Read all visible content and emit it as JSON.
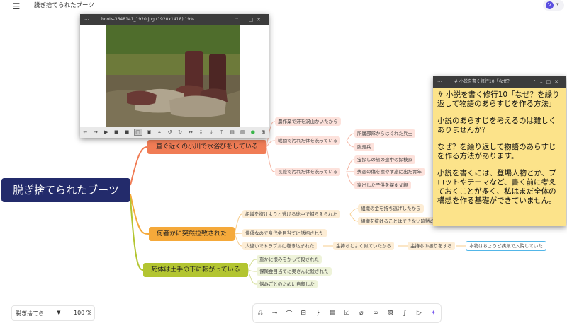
{
  "app": {
    "doc_title": "脱ぎ捨てられたブーツ",
    "avatar_letter": "V"
  },
  "image_window": {
    "title": "boots-3648141_1920.jpg (1920x1418) 19%",
    "controls": [
      "⌃",
      "–",
      "□",
      "✕"
    ],
    "toolbar_icons": [
      "arrow-left",
      "arrow-right",
      "play",
      "stop",
      "stop",
      "select",
      "fit",
      "crop",
      "rotate-left",
      "rotate-right",
      "flip-h",
      "flip-v",
      "download",
      "upload",
      "save",
      "delete",
      "green-dot",
      "grid"
    ]
  },
  "note_window": {
    "title": "# 小説を書く修行10「なぜ？",
    "paragraphs": [
      "# 小説を書く修行10「なぜ？を繰り返して物語のあらすじを作る方法」",
      "小説のあらすじを考えるのは難しくありませんか？",
      "なぜ？を繰り返して物語のあらすじを作る方法があります。",
      "小説を書くには、登場人物とか、プロットやテーマなど、書く前に考えておくことが多く、私はまだ全体の構想を作る基礎ができていません。"
    ]
  },
  "mindmap": {
    "root": "脱ぎ捨てられたブーツ",
    "branch1": {
      "label": "直ぐ近くの小川で水浴びをしている",
      "children": [
        {
          "label": "農作業で汗を沢山かいたから"
        },
        {
          "label": "戦闘で汚れた体を洗っている",
          "children": [
            "所属部隊からはぐれた兵士",
            "脱走兵"
          ]
        },
        {
          "label": "長旅で汚れた体を洗っている",
          "children": [
            "宝探しの旅の途中の探検家",
            "失恋の傷を癒やす旅に出た青年",
            "家出した子供を探す父親"
          ]
        }
      ]
    },
    "branch2": {
      "label": "何者かに突然拉致された",
      "children": [
        {
          "label": "組織を抜けようと逃げる途中で捕らえられた",
          "children": [
            "組織の金を持ち逃げしたから",
            "組織を抜けることはできない暗黙のルール"
          ]
        },
        {
          "label": "俳優なので身代金目当てに誘拐された"
        },
        {
          "label": "人違いでトラブルに巻き込まれた",
          "chain": [
            "金持ちとよく似ていたから",
            "金持ちの振りをする",
            "本物はちょうど病気で入院していた"
          ]
        }
      ]
    },
    "branch3": {
      "label": "死体は土手の下に転がっている",
      "children": [
        "重かに恨みをかって殺された",
        "保険金目当てに奥さんに殺された",
        "悩みごとのために自殺した"
      ]
    }
  },
  "bottom": {
    "map_name": "脱ぎ捨てら...",
    "zoom": "100 %"
  },
  "colors": {
    "root": "#232b6b",
    "branch1": "#f07c55",
    "branch2": "#f5a93a",
    "branch3": "#b3c531",
    "note_bg": "#fce38a"
  }
}
